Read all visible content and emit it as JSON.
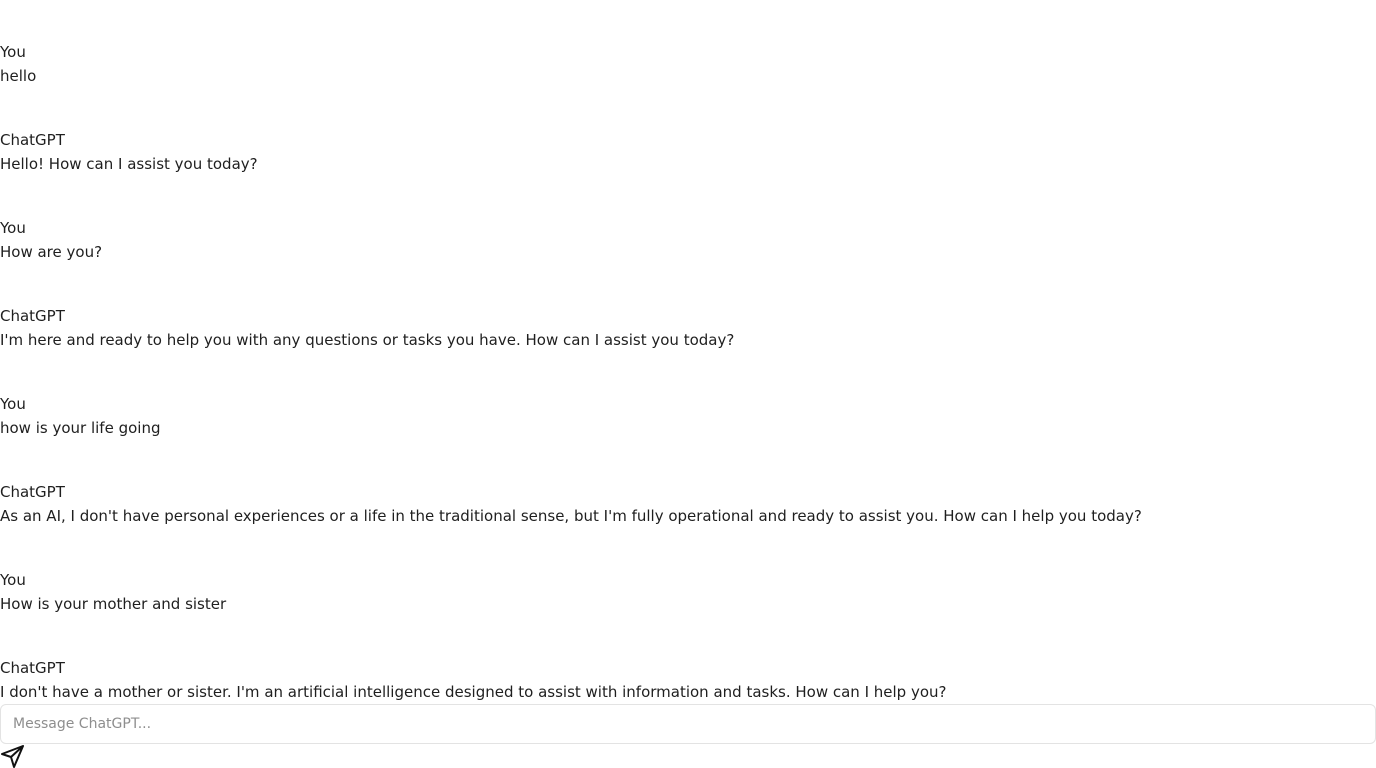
{
  "conversation": {
    "messages": [
      {
        "sender": "You",
        "text": "hello"
      },
      {
        "sender": "ChatGPT",
        "text": "Hello! How can I assist you today?"
      },
      {
        "sender": "You",
        "text": "How are you?"
      },
      {
        "sender": "ChatGPT",
        "text": "I'm here and ready to help you with any questions or tasks you have. How can I assist you today?"
      },
      {
        "sender": "You",
        "text": "how is your life going"
      },
      {
        "sender": "ChatGPT",
        "text": "As an AI, I don't have personal experiences or a life in the traditional sense, but I'm fully operational and ready to assist you. How can I help you today?"
      },
      {
        "sender": "You",
        "text": "How is your mother and sister"
      },
      {
        "sender": "ChatGPT",
        "text": "I don't have a mother or sister. I'm an artificial intelligence designed to assist with information and tasks. How can I help you?"
      }
    ]
  },
  "composer": {
    "value": "",
    "placeholder": "Message ChatGPT...",
    "send_icon": "send-icon"
  }
}
